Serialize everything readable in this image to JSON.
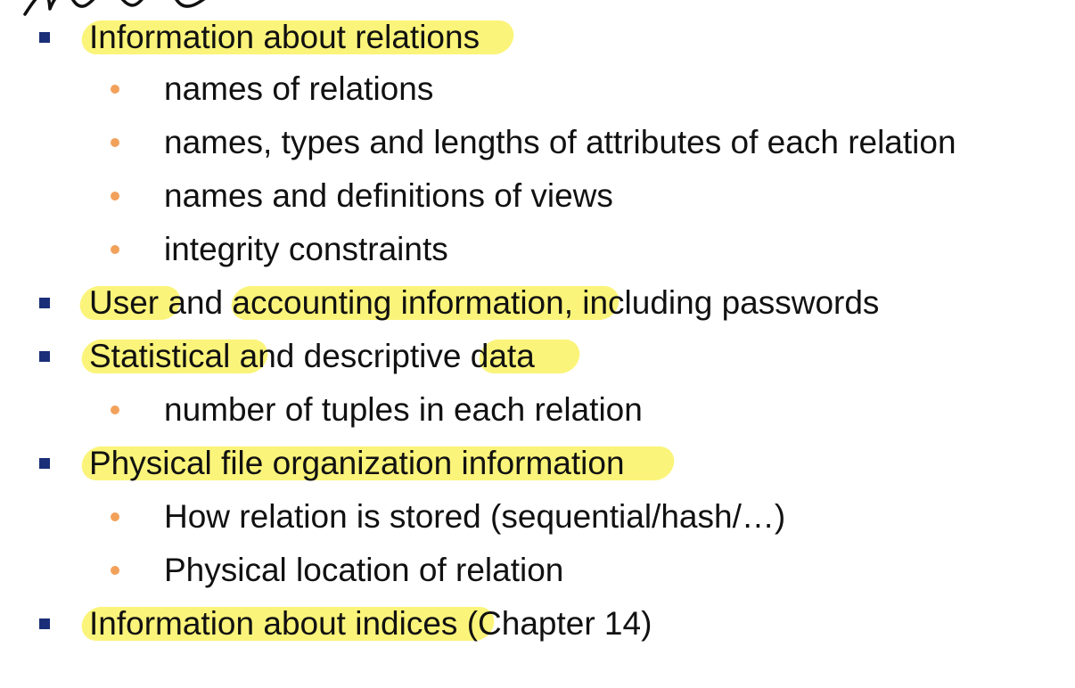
{
  "slide": {
    "items": [
      {
        "text": "Information about relations",
        "subitems": [
          "names of relations",
          "names, types and lengths of attributes of each relation",
          "names and definitions of views",
          "integrity constraints"
        ]
      },
      {
        "text": "User and accounting information, including passwords"
      },
      {
        "text": "Statistical and descriptive data",
        "subitems": [
          "number of tuples in each relation"
        ]
      },
      {
        "text": "Physical file organization information",
        "subitems": [
          "How relation is stored (sequential/hash/…)",
          "Physical location of relation"
        ]
      },
      {
        "text": "Information about indices (Chapter 14)"
      }
    ]
  },
  "colors": {
    "square_bullet": "#1b2f78",
    "round_bullet": "#f2a15b",
    "highlight": "#fbf47a",
    "text": "#111111"
  }
}
